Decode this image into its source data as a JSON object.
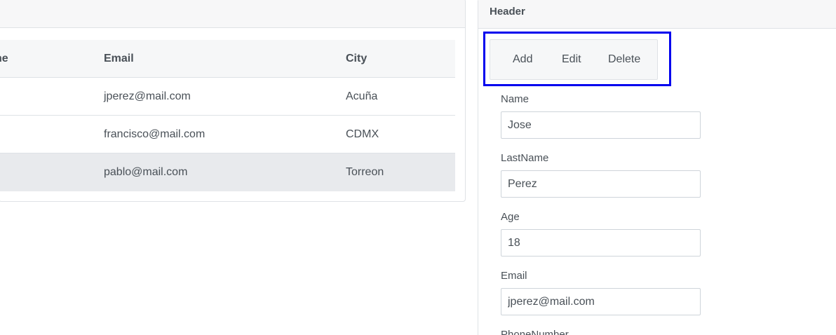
{
  "table": {
    "headers": {
      "name": "ne",
      "email": "Email",
      "city": "City"
    },
    "rows": [
      {
        "email": "jperez@mail.com",
        "city": "Acuña"
      },
      {
        "email": "francisco@mail.com",
        "city": "CDMX"
      },
      {
        "email": "pablo@mail.com",
        "city": "Torreon"
      }
    ],
    "selected_row_index": 2
  },
  "panel": {
    "header_title": "Header",
    "toolbar": {
      "add_label": "Add",
      "edit_label": "Edit",
      "delete_label": "Delete"
    },
    "form": {
      "name": {
        "label": "Name",
        "value": "Jose"
      },
      "lastname": {
        "label": "LastName",
        "value": "Perez"
      },
      "age": {
        "label": "Age",
        "value": "18"
      },
      "email": {
        "label": "Email",
        "value": "jperez@mail.com"
      },
      "phone": {
        "label": "PhoneNumber"
      }
    }
  },
  "colors": {
    "highlight_border": "#0000ee",
    "selected_row_bg": "#e8eaed",
    "header_bg": "#f7f7f8"
  }
}
